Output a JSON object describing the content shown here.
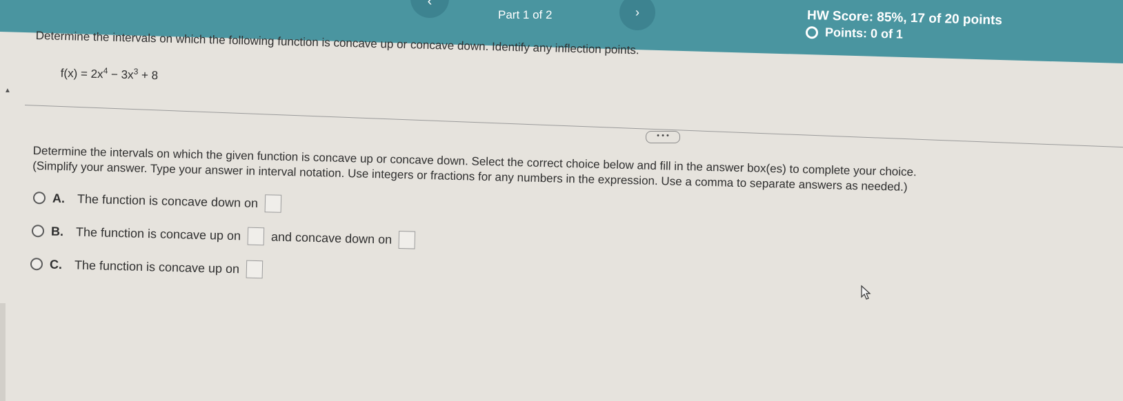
{
  "header": {
    "part_label": "Part 1 of 2",
    "top_strip_text": "",
    "prev_icon": "chevron-left-icon",
    "next_icon": "chevron-right-icon",
    "hw_score": "HW Score: 85%, 17 of 20 points",
    "points": "Points: 0 of 1"
  },
  "question": {
    "text": "Determine the intervals on which the following function is concave up or concave down. Identify any inflection points.",
    "formula_prefix": "f(x) = 2x",
    "exp1": "4",
    "formula_mid": " − 3x",
    "exp2": "3",
    "formula_suffix": " + 8"
  },
  "more_button": "• • •",
  "instructions": {
    "line1": "Determine the intervals on which the given function is concave up or concave down. Select the correct choice below and fill in the answer box(es) to complete your choice.",
    "line2": "(Simplify your answer. Type your answer in interval notation. Use integers or fractions for any numbers in the expression. Use a comma to separate answers as needed.)"
  },
  "choices": {
    "a": {
      "letter": "A.",
      "text": "The function is concave down on"
    },
    "b": {
      "letter": "B.",
      "text": "The function is concave up on",
      "text2": "and concave down on"
    },
    "c": {
      "letter": "C.",
      "text": "The function is concave up on"
    }
  },
  "colors": {
    "banner": "#4a95a0",
    "background": "#e6e3dd"
  }
}
